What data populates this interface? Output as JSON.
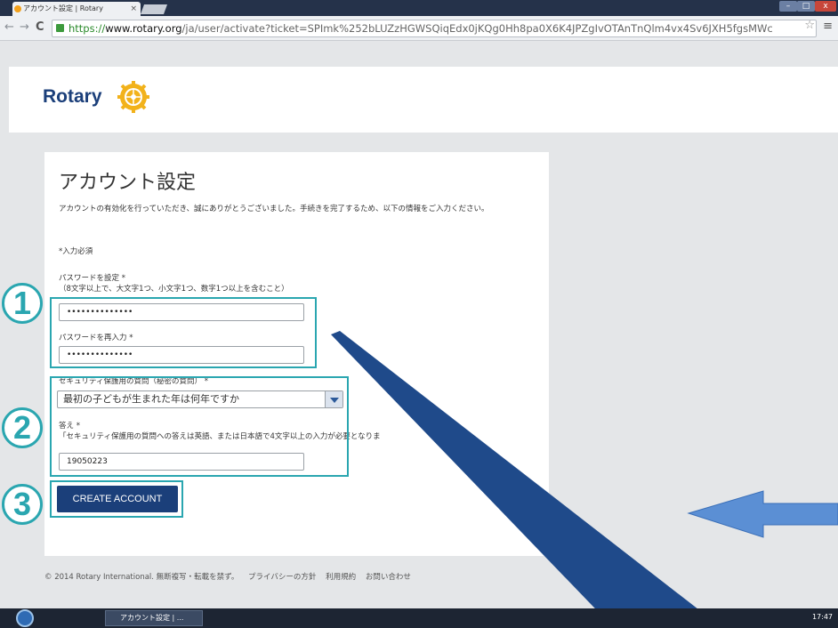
{
  "browser": {
    "tab_title": "アカウント設定 | Rotary",
    "tab_close": "×",
    "url_scheme": "https://",
    "url_host": "www.rotary.org",
    "url_rest": "/ja/user/activate?ticket=SPImk%252bLUZzHGWSQiqEdx0jKQg0Hh8pa0X6K4JPZgIvOTAnTnQlm4vx4Sv6JXH5fgsMWc",
    "star": "☆",
    "menu": "≡",
    "back": "←",
    "forward": "→",
    "reload": "C",
    "win_close": "x"
  },
  "header": {
    "logo_text": "Rotary"
  },
  "form": {
    "title": "アカウント設定",
    "intro": "アカウントの有効化を行っていただき、誠にありがとうございました。手続きを完了するため、以下の情報をご入力ください。",
    "required_note": "*入力必須",
    "password_label": "パスワードを設定 *",
    "password_hint": "（8文字以上で、大文字1つ、小文字1つ、数字1つ以上を含むこと）",
    "password_value": "••••••••••••••",
    "password_confirm_label": "パスワードを再入力 *",
    "password_confirm_value": "••••••••••••••",
    "security_question_label": "セキュリティ保護用の質問（秘密の質問） *",
    "security_question_value": "最初の子どもが生まれた年は何年ですか",
    "answer_label": "答え *",
    "answer_hint": "「セキュリティ保護用の質問への答えは英語、または日本語で4文字以上の入力が必要となりま",
    "answer_value": "19050223",
    "create_button": "CREATE ACCOUNT"
  },
  "footer": {
    "copyright": "© 2014 Rotary International. 無断複写・転載を禁ず。",
    "privacy": "プライバシーの方針",
    "terms": "利用規約",
    "contact": "お問い合わせ"
  },
  "annotations": {
    "step1": "1",
    "step2": "2",
    "step3": "3",
    "highlight_color": "#2aa6b0",
    "pointer_color": "#1f4a8a",
    "arrow_color": "#5b8fd4"
  },
  "taskbar": {
    "task_label": "アカウント設定 | ...",
    "clock": "17:47"
  }
}
